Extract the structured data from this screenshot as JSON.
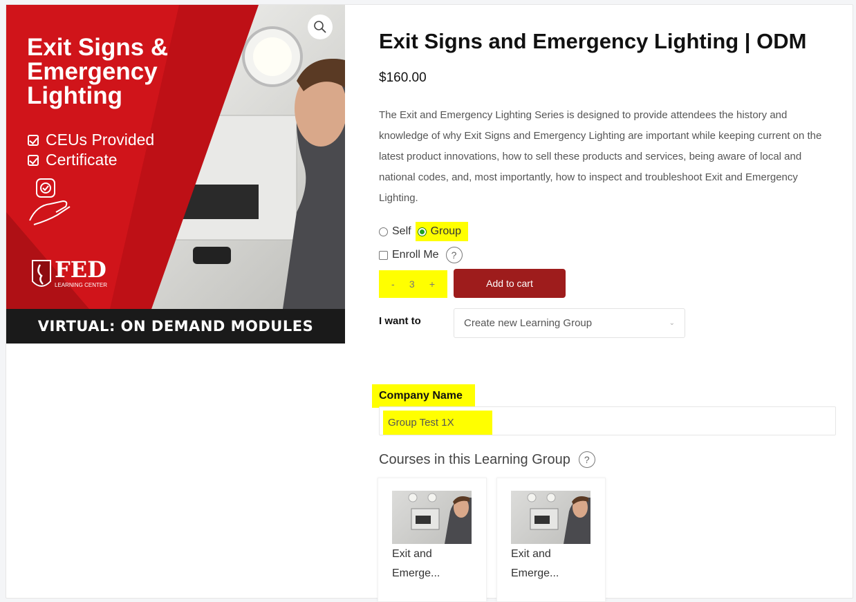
{
  "product": {
    "title": "Exit Signs and Emergency Lighting | ODM",
    "price": "$160.00",
    "description": "The Exit and Emergency Lighting Series is designed to provide attendees the history and knowledge of why Exit Signs and Emergency Lighting are important while keeping current on the latest product innovations, how to sell these products and services, being aware of local and national codes, and, most importantly, how to inspect and troubleshoot Exit and Emergency Lighting."
  },
  "image": {
    "title": "Exit Signs & Emergency Lighting",
    "bullet1": "CEUs Provided",
    "bullet2": "Certificate",
    "logo_text": "FED",
    "logo_sub": "LEARNING CENTER",
    "banner": "VIRTUAL: ON DEMAND MODULES",
    "zoom_icon": "search-icon",
    "colors": {
      "red": "#d0141a",
      "dark_red": "#8e0c10",
      "banner": "#1a1a1a"
    }
  },
  "purchase": {
    "option_self": "Self",
    "option_group": "Group",
    "selected": "Group",
    "enroll_label": "Enroll Me",
    "enroll_checked": false,
    "help_icon": "question-icon",
    "qty_minus": "-",
    "qty_value": "3",
    "qty_plus": "+",
    "add_to_cart": "Add to cart",
    "button_color": "#9e1c1c",
    "i_want_label": "I want to",
    "i_want_value": "Create new Learning Group"
  },
  "group": {
    "company_label": "Company Name",
    "company_value": "Group Test 1X",
    "courses_heading": "Courses in this Learning Group",
    "courses": [
      {
        "name": "Exit and Emerge..."
      },
      {
        "name": "Exit and Emerge..."
      }
    ]
  },
  "highlight_color": "#ffff00"
}
